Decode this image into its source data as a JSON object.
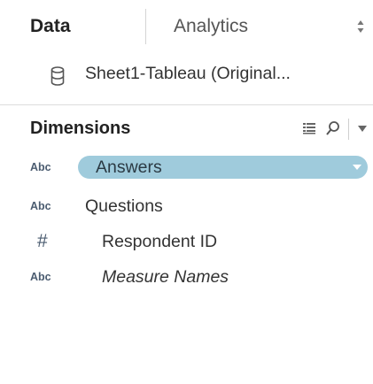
{
  "tabs": {
    "data_label": "Data",
    "analytics_label": "Analytics"
  },
  "datasource": {
    "name": "Sheet1-Tableau (Original..."
  },
  "dimensions": {
    "title": "Dimensions"
  },
  "fields": [
    {
      "type": "Abc",
      "label": "Answers",
      "selected": true
    },
    {
      "type": "Abc",
      "label": "Questions"
    },
    {
      "type": "#",
      "label": "Respondent ID"
    },
    {
      "type": "Abc",
      "label": "Measure Names"
    }
  ],
  "colors": {
    "selected_pill": "#9fcbdc",
    "type_glyph": "#4b5c70",
    "text": "#333333"
  },
  "icons": {
    "datasource": "database-icon",
    "list_view": "list-view-icon",
    "search": "search-icon",
    "menu": "dropdown-menu-icon",
    "tab_sort": "sort-arrows-icon"
  }
}
